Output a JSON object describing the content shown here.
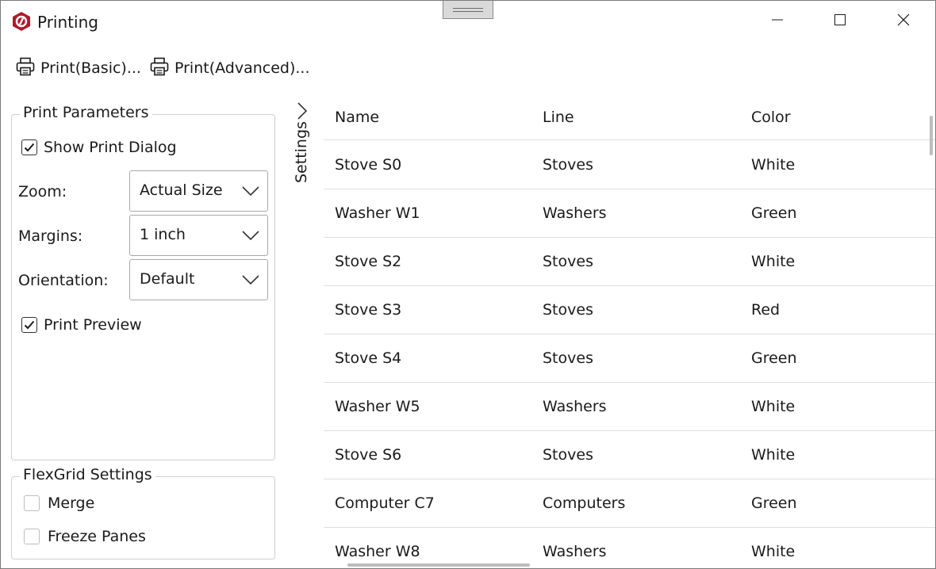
{
  "window": {
    "title": "Printing",
    "app_icon": "app-logo-icon",
    "controls": [
      "minimize-icon",
      "maximize-icon",
      "close-icon"
    ]
  },
  "toolbar": {
    "print_basic_label": "Print(Basic)...",
    "print_advanced_label": "Print(Advanced)...",
    "icon": "printer-icon"
  },
  "print_parameters": {
    "title": "Print Parameters",
    "show_print_dialog": {
      "label": "Show Print Dialog",
      "checked": true
    },
    "zoom": {
      "label": "Zoom:",
      "value": "Actual Size"
    },
    "margins": {
      "label": "Margins:",
      "value": "1 inch"
    },
    "orientation": {
      "label": "Orientation:",
      "value": "Default"
    },
    "print_preview": {
      "label": "Print Preview",
      "checked": true
    }
  },
  "flexgrid_settings": {
    "title": "FlexGrid Settings",
    "merge": {
      "label": "Merge",
      "checked": false
    },
    "freeze_panes": {
      "label": "Freeze Panes",
      "checked": false
    }
  },
  "settings_panel": {
    "label": "Settings"
  },
  "grid": {
    "columns": [
      "Name",
      "Line",
      "Color"
    ],
    "rows": [
      [
        "Stove S0",
        "Stoves",
        "White"
      ],
      [
        "Washer W1",
        "Washers",
        "Green"
      ],
      [
        "Stove S2",
        "Stoves",
        "White"
      ],
      [
        "Stove S3",
        "Stoves",
        "Red"
      ],
      [
        "Stove S4",
        "Stoves",
        "Green"
      ],
      [
        "Washer W5",
        "Washers",
        "White"
      ],
      [
        "Stove S6",
        "Stoves",
        "White"
      ],
      [
        "Computer C7",
        "Computers",
        "Green"
      ],
      [
        "Washer W8",
        "Washers",
        "White"
      ]
    ]
  },
  "colors": {
    "brand": "#b2182b",
    "border": "#cfcfcf",
    "grid_line": "#dedede"
  }
}
